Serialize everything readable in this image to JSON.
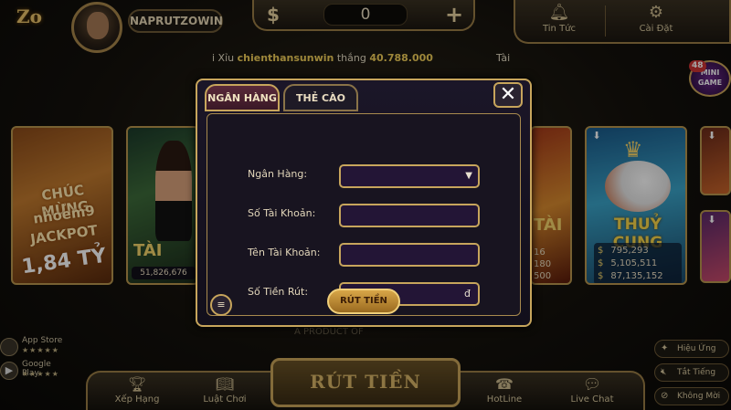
{
  "header": {
    "logo": "Zo",
    "username": "NAPRUTZOWIN",
    "currency_symbol": "$",
    "balance": "0",
    "add_symbol": "+",
    "news_label": "Tin Tức",
    "settings_label": "Cài Đặt"
  },
  "ticker": {
    "prefix": "i Xỉu",
    "winner": "chienthansunwin",
    "verb": "thắng",
    "amount": "40.788.000",
    "suffix": "Tài"
  },
  "minigame": {
    "count": "48",
    "label": "MINI GAME"
  },
  "cards": {
    "jackpot": {
      "line1": "CHÚC MỪNG",
      "line2": "nhoem9",
      "line3": "JACKPOT",
      "amount": "1,84 TỶ"
    },
    "taixiu": {
      "label": "TÀI",
      "value": "51,826,676"
    },
    "partial": {
      "label": "TÀI",
      "values": [
        "16",
        "180",
        "500"
      ]
    },
    "thuycung": {
      "label": "THUỶ CUNG",
      "values": [
        "795,293",
        "5,105,511",
        "87,135,152"
      ],
      "currency": "$"
    }
  },
  "footer_product": "A PRODUCT OF",
  "stores": {
    "apple": "App Store",
    "google": "Google Play",
    "stars": "★★★★★"
  },
  "right_toggles": [
    "Hiệu Ứng",
    "Tắt Tiếng",
    "Không Mời"
  ],
  "bottom": {
    "rank": "Xếp Hạng",
    "rules": "Luật Chơi",
    "withdraw": "RÚT TIỀN",
    "hotline": "HotLine",
    "chat": "Live Chat"
  },
  "modal": {
    "tabs": {
      "bank": "NGÂN HÀNG",
      "card": "THẺ CÀO"
    },
    "close": "✕",
    "labels": {
      "bank": "Ngân Hàng:",
      "account_number": "Số Tài Khoản:",
      "account_name": "Tên Tài Khoản:",
      "amount": "Số Tiền Rút:"
    },
    "fields": {
      "bank": "",
      "account_number": "",
      "account_name": "",
      "amount": ""
    },
    "currency_unit": "đ",
    "submit": "RÚT TIỀN"
  },
  "icons": {
    "news": "bell-icon",
    "settings": "gear-icon",
    "rank": "trophy-icon",
    "rules": "book-icon",
    "hotline": "phone-icon",
    "chat": "chat-bubble-icon",
    "history": "history-icon",
    "apple": "apple-icon",
    "google": "play-icon"
  },
  "colors": {
    "gold": "#c7a55c",
    "highlight_name": "#f2cf5a",
    "modal_bg": "#181420"
  }
}
